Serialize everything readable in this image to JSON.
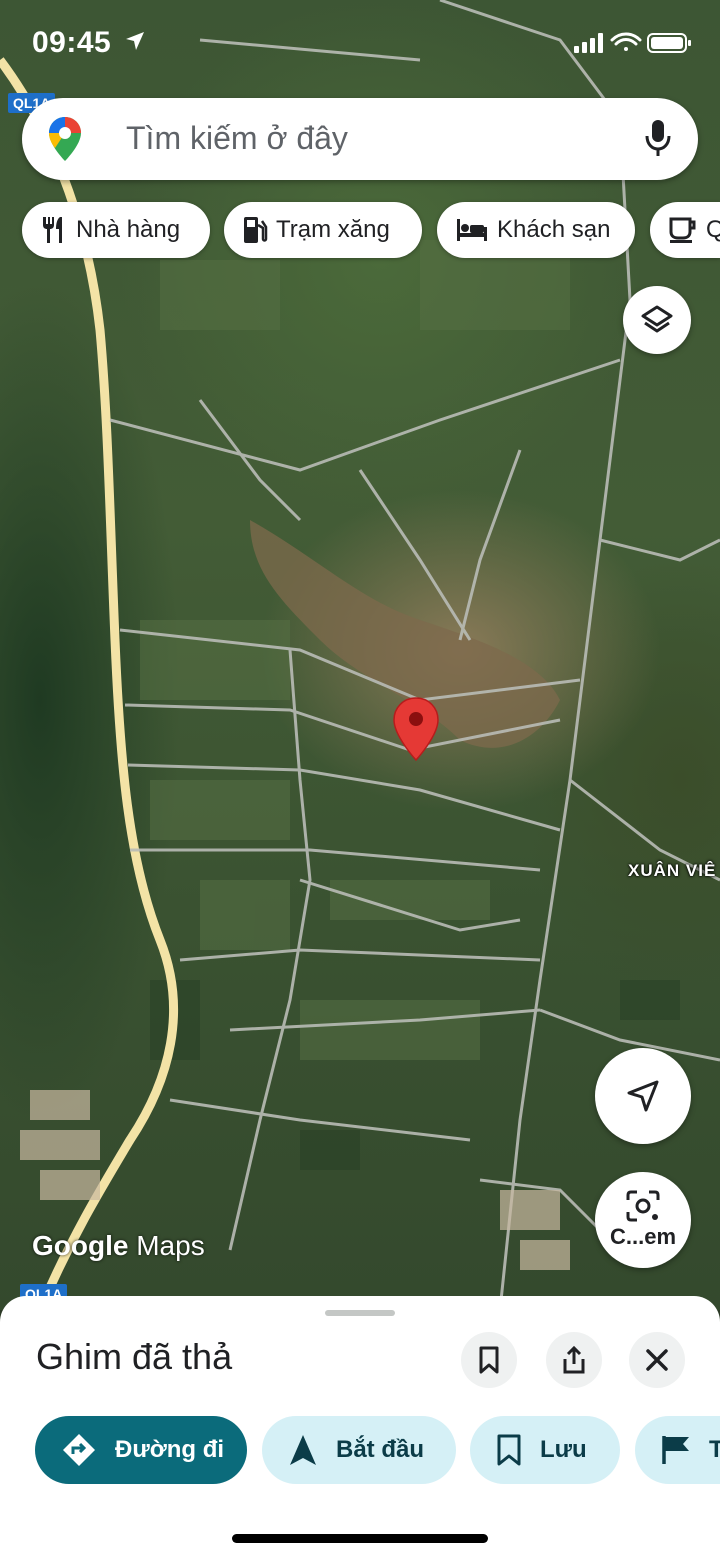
{
  "status_bar": {
    "time": "09:45"
  },
  "search": {
    "placeholder": "Tìm kiếm ở đây"
  },
  "chips": [
    {
      "label": "Nhà hàng",
      "icon": "restaurant-icon"
    },
    {
      "label": "Trạm xăng",
      "icon": "gas-station-icon"
    },
    {
      "label": "Khách sạn",
      "icon": "hotel-icon"
    },
    {
      "label": "Q",
      "icon": "coffee-icon"
    }
  ],
  "map": {
    "place_label": "XUÂN VIÊ",
    "road_badge_top": "QL1A",
    "road_badge_bottom": "QL1A",
    "attribution_google": "Google",
    "attribution_maps": "Maps",
    "lens_label": "C...em",
    "icons": [
      "layers-icon",
      "recenter-icon",
      "lens-icon",
      "red-pin-icon"
    ]
  },
  "sheet": {
    "title": "Ghim đã thả",
    "icons": [
      "bookmark-icon",
      "share-icon",
      "close-icon"
    ],
    "actions": [
      {
        "label": "Đường đi",
        "icon": "directions-icon"
      },
      {
        "label": "Bắt đầu",
        "icon": "navigation-arrow-icon"
      },
      {
        "label": "Lưu",
        "icon": "bookmark-icon"
      },
      {
        "label": "T",
        "icon": "flag-icon"
      }
    ]
  },
  "colors": {
    "pin": "#e53935",
    "primary_action": "#0b6b7b",
    "secondary_action": "#d5f0f6",
    "highway": "#f3e3a6"
  }
}
